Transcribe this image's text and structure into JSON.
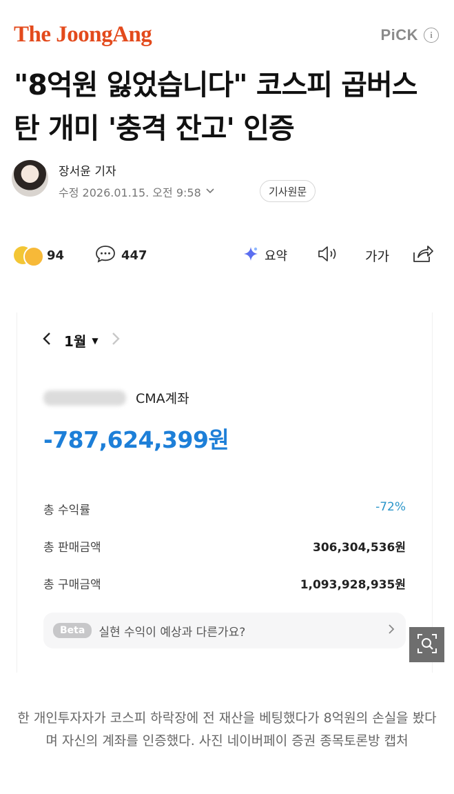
{
  "header": {
    "logo": "The JoongAng",
    "pick_label": "PiCK",
    "info_icon": "info-icon"
  },
  "article": {
    "headline": "\"8억원 잃었습니다\" 코스피 곱버스 탄 개미 '충격 잔고' 인증",
    "reporter": "장서윤 기자",
    "modified": "수정 2026.01.15. 오전 9:58",
    "original_button": "기사원문"
  },
  "actions": {
    "reactions_count": "94",
    "comments_count": "447",
    "summary_label": "요약",
    "font_label": "가가"
  },
  "screenshot": {
    "month": "1월",
    "account_type": "CMA계좌",
    "balance": "-787,624,399원",
    "stats": [
      {
        "label": "총 수익률",
        "value": "-72%"
      },
      {
        "label": "총 판매금액",
        "value": "306,304,536원"
      },
      {
        "label": "총 구매금액",
        "value": "1,093,928,935원"
      }
    ],
    "beta_badge": "Beta",
    "beta_text": "실현 수익이 예상과 다른가요?"
  },
  "caption": "한 개인투자자가 코스피 하락장에 전 재산을 베팅했다가 8억원의 손실을 봤다며 자신의 계좌를 인증했다. 사진 네이버페이 증권 종목토론방 캡처",
  "colors": {
    "brand": "#e34a1c",
    "balance": "#1d7fd8",
    "rate": "#2a95c9"
  }
}
